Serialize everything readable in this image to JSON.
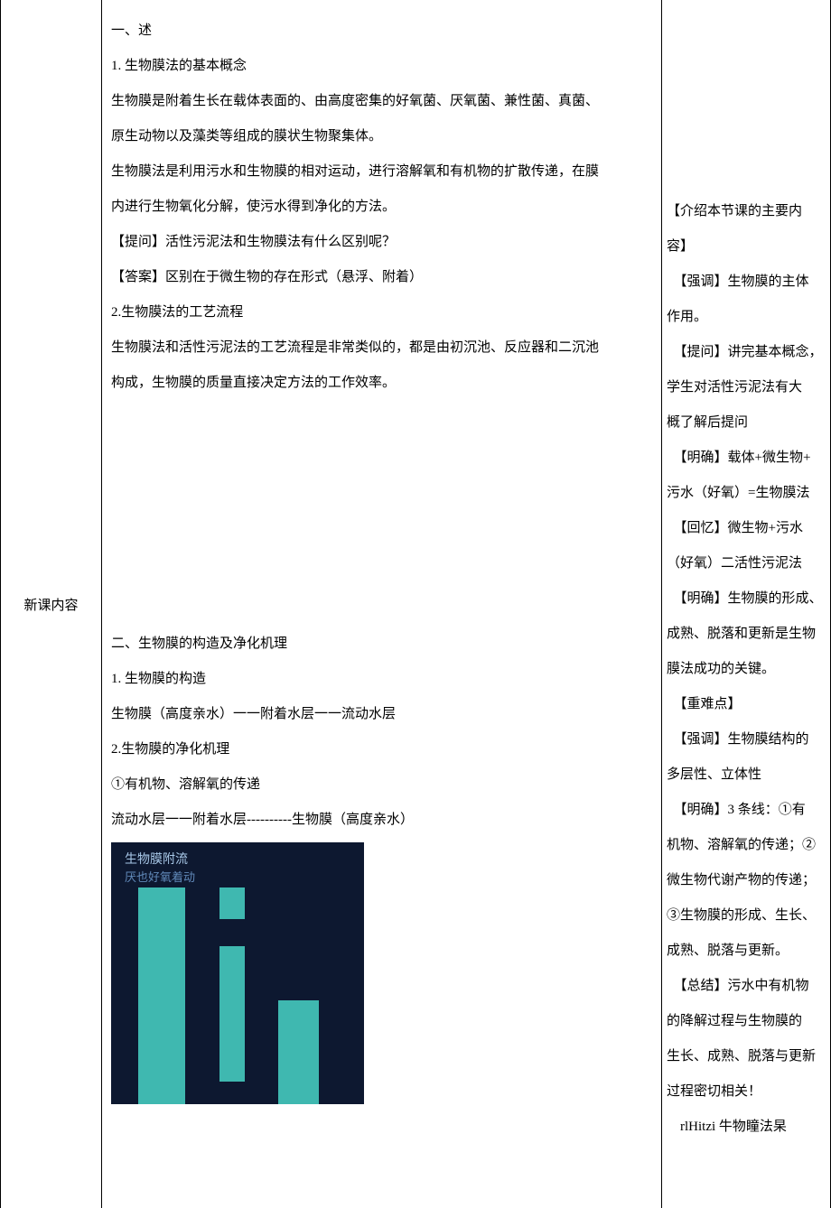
{
  "leftColumn": {
    "label": "新课内容"
  },
  "middleColumn": {
    "lines": [
      "一、述",
      "1. 生物膜法的基本概念",
      "生物膜是附着生长在载体表面的、由高度密集的好氧菌、厌氧菌、兼性菌、真菌、",
      "原生动物以及藻类等组成的膜状生物聚集体。",
      "生物膜法是利用污水和生物膜的相对运动，进行溶解氧和有机物的扩散传递，在膜",
      "内进行生物氧化分解，使污水得到净化的方法。",
      "【提问】活性污泥法和生物膜法有什么区别呢？",
      "【答案】区别在于微生物的存在形式（悬浮、附着）",
      "2.生物膜法的工艺流程",
      "生物膜法和活性污泥法的工艺流程是非常类似的，都是由初沉池、反应器和二沉池",
      "构成，生物膜的质量直接决定方法的工作效率。"
    ],
    "section2": [
      "二、生物膜的构造及净化机理",
      "1. 生物膜的构造",
      "生物膜（高度亲水）一一附着水层一一流动水层",
      "2.生物膜的净化机理",
      "①有机物、溶解氧的传递",
      "流动水层一一附着水层----------生物膜（高度亲水）"
    ],
    "diagram": {
      "label1": "生物膜附流",
      "label2": "厌也好氧着动"
    }
  },
  "rightColumn": {
    "lines": [
      "【介绍本节课的主要内",
      "容】",
      "　【强调】生物膜的主体",
      "作用。",
      "　【提问】讲完基本概念，",
      "学生对活性污泥法有大",
      "概了解后提问",
      "　【明确】载体+微生物+",
      "污水（好氧）=生物膜法",
      "　【回忆】微生物+污水",
      "（好氧）二活性污泥法",
      "　【明确】生物膜的形成、",
      "成熟、脱落和更新是生物",
      "膜法成功的关键。",
      "　【重难点】",
      "　【强调】生物膜结构的",
      "多层性、立体性",
      "　【明确】3 条线：①有",
      "机物、溶解氧的传递；②",
      "微生物代谢产物的传递；",
      "③生物膜的形成、生长、",
      "成熟、脱落与更新。",
      "　【总结】污水中有机物",
      "的降解过程与生物膜的",
      "生长、成熟、脱落与更新",
      "过程密切相关！",
      "　rlHitzi 牛物瞳法杲"
    ]
  }
}
